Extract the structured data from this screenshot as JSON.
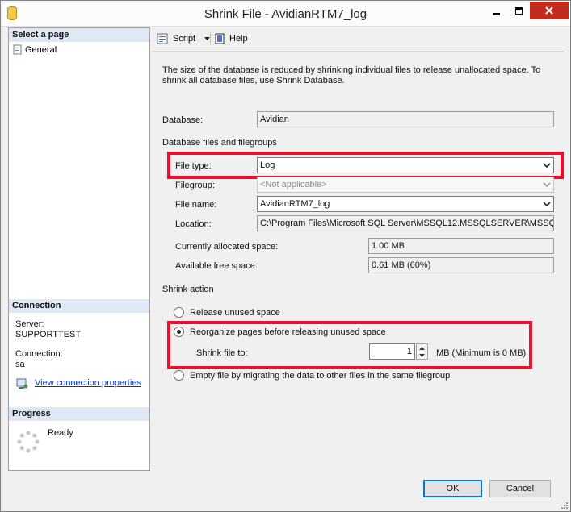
{
  "window": {
    "title": "Shrink File - AvidianRTM7_log",
    "close_color": "#c42b1c"
  },
  "left_panel": {
    "select_page_header": "Select a page",
    "pages": [
      {
        "label": "General",
        "icon": "page-icon"
      }
    ],
    "connection_header": "Connection",
    "server_label": "Server:",
    "server_value": "SUPPORTTEST",
    "connection_label": "Connection:",
    "connection_value": "sa",
    "view_connection_link": "View connection properties",
    "progress_header": "Progress",
    "progress_status": "Ready"
  },
  "toolbar": {
    "script_label": "Script",
    "help_label": "Help"
  },
  "main": {
    "description": "The size of the database is reduced by shrinking individual files to release unallocated space. To shrink all database files, use Shrink Database.",
    "database_label": "Database:",
    "database_value": "Avidian",
    "files_group_label": "Database files and filegroups",
    "file_type_label": "File type:",
    "file_type_value": "Log",
    "filegroup_label": "Filegroup:",
    "filegroup_value": "<Not applicable>",
    "file_name_label": "File name:",
    "file_name_value": "AvidianRTM7_log",
    "location_label": "Location:",
    "location_value": "C:\\Program Files\\Microsoft SQL Server\\MSSQL12.MSSQLSERVER\\MSSQL",
    "allocated_label": "Currently allocated space:",
    "allocated_value": "1.00 MB",
    "free_label": "Available free space:",
    "free_value": "0.61 MB (60%)",
    "shrink_action_label": "Shrink action",
    "option_release": "Release unused space",
    "option_reorganize": "Reorganize pages before releasing unused space",
    "shrink_to_label": "Shrink file to:",
    "shrink_to_value": "1",
    "shrink_to_unit": "MB (Minimum is 0 MB)",
    "option_empty": "Empty file by migrating the data to other files in the same filegroup",
    "selected_option": "reorganize",
    "highlight_color": "#e8112d"
  },
  "footer": {
    "ok_label": "OK",
    "cancel_label": "Cancel"
  }
}
